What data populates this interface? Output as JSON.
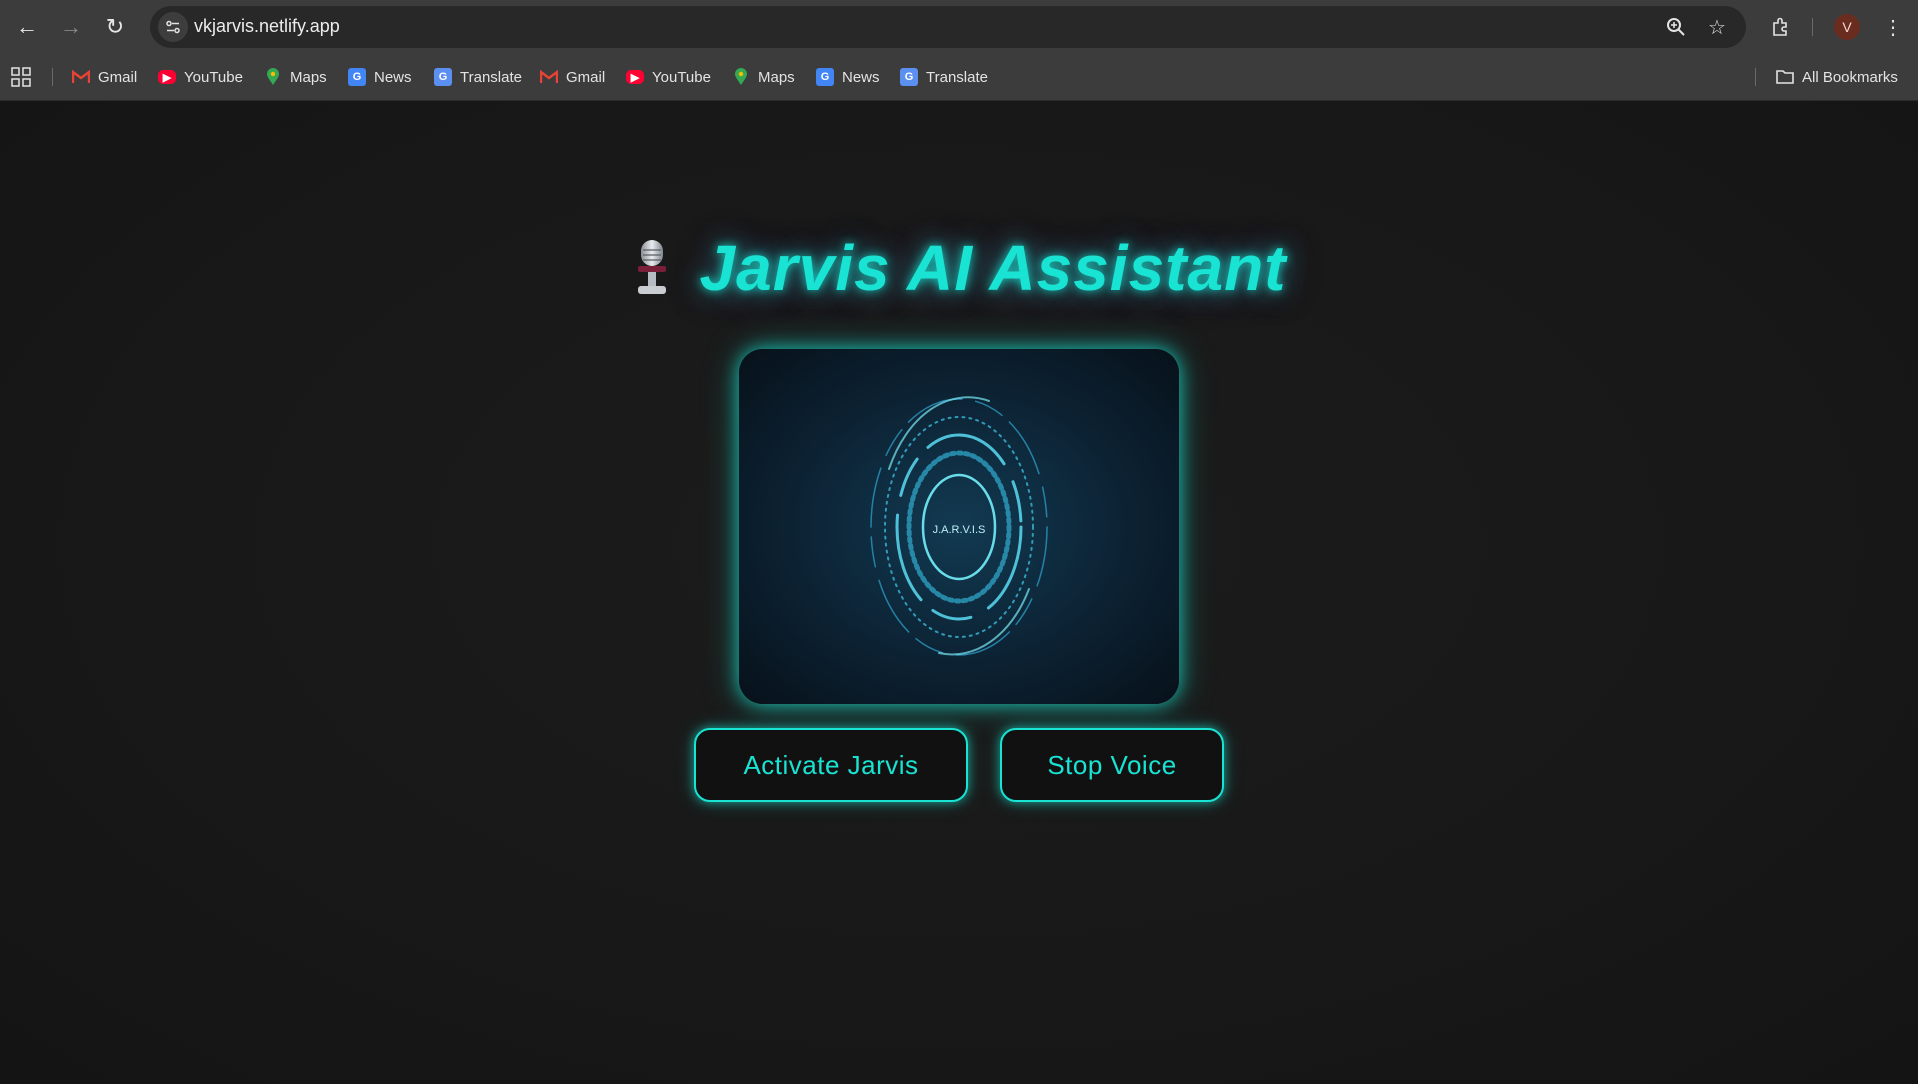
{
  "browser": {
    "url": "vkjarvis.netlify.app",
    "profile_initial": "V",
    "bookmarks": [
      {
        "label": "Gmail",
        "icon": "gmail-icon"
      },
      {
        "label": "YouTube",
        "icon": "youtube-icon"
      },
      {
        "label": "Maps",
        "icon": "maps-icon"
      },
      {
        "label": "News",
        "icon": "news-icon"
      },
      {
        "label": "Translate",
        "icon": "translate-icon"
      },
      {
        "label": "Gmail",
        "icon": "gmail-icon"
      },
      {
        "label": "YouTube",
        "icon": "youtube-icon"
      },
      {
        "label": "Maps",
        "icon": "maps-icon"
      },
      {
        "label": "News",
        "icon": "news-icon"
      },
      {
        "label": "Translate",
        "icon": "translate-icon"
      }
    ],
    "all_bookmarks_label": "All Bookmarks"
  },
  "page": {
    "title": "Jarvis AI Assistant",
    "title_icon": "microphone-icon",
    "video_label": "J.A.R.V.I.S",
    "activate_label": "Activate Jarvis",
    "stop_label": "Stop Voice"
  },
  "colors": {
    "accent": "#19e3d2",
    "background": "#171717",
    "chrome": "#3c3c3c"
  }
}
